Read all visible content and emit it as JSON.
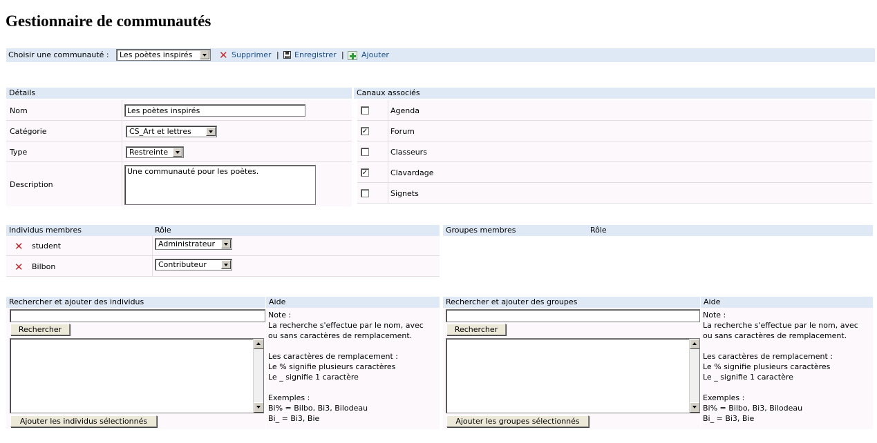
{
  "page": {
    "title": "Gestionnaire de communautés"
  },
  "toolbar": {
    "choose_label": "Choisir une communauté :",
    "selected_community": "Les poètes inspirés",
    "delete_label": "Supprimer",
    "save_label": "Enregistrer",
    "add_label": "Ajouter",
    "separator": "|"
  },
  "details": {
    "header": "Détails",
    "name_label": "Nom",
    "name_value": "Les poètes inspirés",
    "category_label": "Catégorie",
    "category_value": "CS_Art et lettres",
    "type_label": "Type",
    "type_value": "Restreinte",
    "description_label": "Description",
    "description_value": "Une communauté pour les poètes."
  },
  "channels": {
    "header": "Canaux associés",
    "items": [
      {
        "label": "Agenda",
        "checked": false,
        "mark": ""
      },
      {
        "label": "Forum",
        "checked": true,
        "mark": "✓"
      },
      {
        "label": "Classeurs",
        "checked": false,
        "mark": ""
      },
      {
        "label": "Clavardage",
        "checked": true,
        "mark": "✓"
      },
      {
        "label": "Signets",
        "checked": false,
        "mark": ""
      }
    ]
  },
  "members": {
    "header": "Individus membres",
    "role_header": "Rôle",
    "rows": [
      {
        "name": "student",
        "role": "Administrateur"
      },
      {
        "name": "Bilbon",
        "role": "Contributeur"
      }
    ]
  },
  "groups": {
    "header": "Groupes membres",
    "role_header": "Rôle"
  },
  "search_individuals": {
    "header": "Rechercher et ajouter des individus",
    "query": "",
    "search_button": "Rechercher",
    "add_button": "Ajouter les individus sélectionnés"
  },
  "search_groups": {
    "header": "Rechercher et ajouter des groupes",
    "query": "",
    "search_button": "Rechercher",
    "add_button": "Ajouter les groupes sélectionnés"
  },
  "help": {
    "header": "Aide",
    "text": "Note :\nLa recherche s'effectue par le nom, avec\nou sans caractères de remplacement.\n\nLes caractères de remplacement :\nLe % signifie plusieurs caractères\nLe _ signifie 1 caractère\n\nExemples :\nBi% = Bilbo, Bi3, Bilodeau\nBi_ = Bi3, Bie"
  },
  "colors": {
    "header_bg": "#dfe9f5",
    "cell_bg": "#fcf8fc",
    "link": "#1a4f8a",
    "delete_red": "#c0272d",
    "add_green": "#2e9a3a"
  }
}
